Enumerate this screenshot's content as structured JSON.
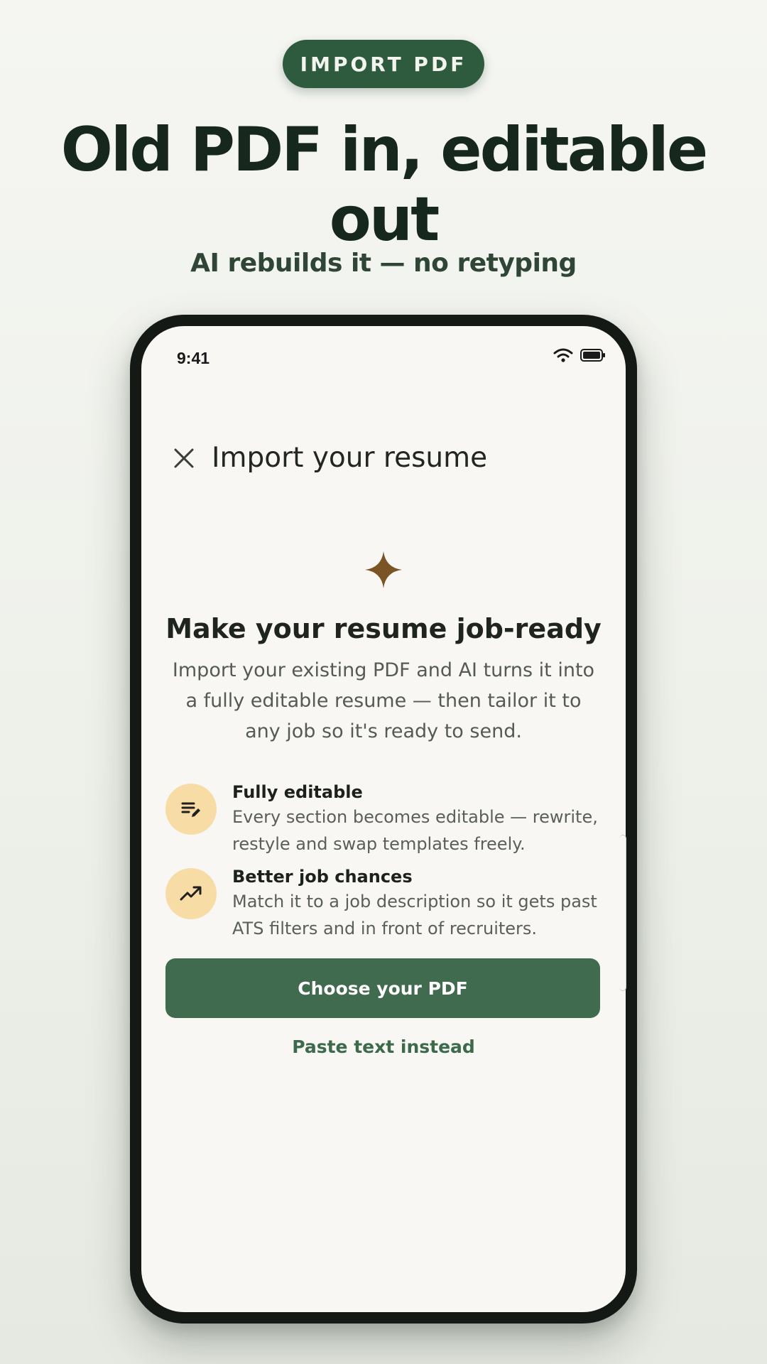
{
  "banner": {
    "pill_label": "IMPORT PDF",
    "headline": "Old PDF in, editable out",
    "subheadline": "AI rebuilds it — no retyping"
  },
  "status_bar": {
    "time": "9:41",
    "icons": [
      "wifi-icon",
      "battery-icon"
    ]
  },
  "screen": {
    "title": "Import your resume",
    "close_icon": "close-icon",
    "hero_icon": "sparkle-icon",
    "card_title": "Make your resume job-ready",
    "card_description": "Import your existing PDF and AI turns it into a fully editable resume — then tailor it to any job so it's ready to send.",
    "features": [
      {
        "icon": "edit-lines-icon",
        "title": "Fully editable",
        "body": "Every section becomes editable — rewrite, restyle and swap templates freely."
      },
      {
        "icon": "trending-up-icon",
        "title": "Better job chances",
        "body": "Match it to a job description so it gets past ATS filters and in front of recruiters."
      }
    ],
    "primary_button": "Choose your PDF",
    "secondary_link": "Paste text instead"
  },
  "colors": {
    "brand_green": "#2e5a3d",
    "button_green": "#416b4e",
    "sparkle_brown": "#7a5424",
    "feature_circle": "#f8dca6"
  }
}
